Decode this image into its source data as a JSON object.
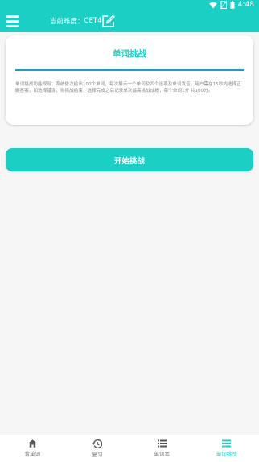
{
  "status": {
    "time": "4:48",
    "icons": [
      "wifi-icon",
      "no-sim-icon",
      "battery-icon"
    ]
  },
  "header": {
    "difficulty_label": "当前难度：",
    "difficulty_value": "CET4",
    "accent": "#1ccfc4"
  },
  "card": {
    "title": "单词挑战",
    "rules": "单词挑战功能规则：系统依次给出100个单词，每次展示一个单词及四个选项及单词发音。用户需在15秒内选择正确答案，如选择错误，则挑战结束，选择完成之后记录单次最高挑战成绩，每个单词1分 共100分。"
  },
  "start_button": {
    "label": "开始挑战"
  },
  "bottom_nav": [
    {
      "label": "背单词",
      "icon": "home-icon",
      "active": false
    },
    {
      "label": "复习",
      "icon": "history-icon",
      "active": false
    },
    {
      "label": "单词本",
      "icon": "list-icon",
      "active": false
    },
    {
      "label": "单词挑战",
      "icon": "list-icon",
      "active": true
    }
  ]
}
